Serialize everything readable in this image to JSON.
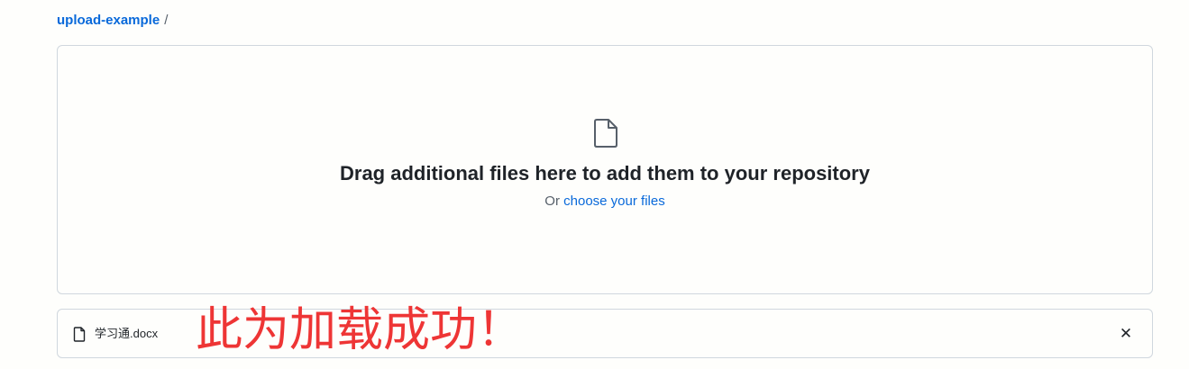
{
  "breadcrumb": {
    "repo": "upload-example",
    "separator": "/"
  },
  "dropzone": {
    "icon": "file-icon",
    "headline": "Drag additional files here to add them to your repository",
    "or_text": "Or",
    "choose_link": "choose your files"
  },
  "uploaded_file": {
    "icon": "file-icon",
    "name": "学习通.docx",
    "remove_symbol": "✕"
  },
  "annotation": {
    "text": "此为加载成功！",
    "color": "#ee3535"
  },
  "colors": {
    "link": "#0969da",
    "border": "#d0d7de",
    "text": "#1f2328",
    "muted": "#57606a"
  }
}
